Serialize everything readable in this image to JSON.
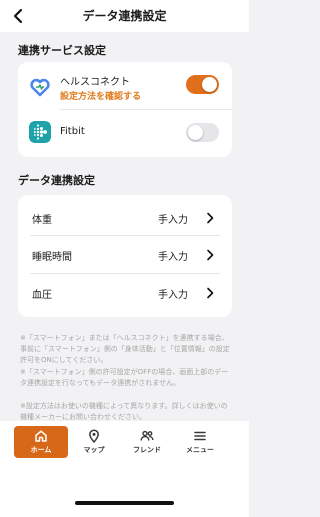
{
  "header": {
    "title": "データ連携設定"
  },
  "services_section": {
    "title": "連携サービス設定",
    "items": [
      {
        "name": "ヘルスコネクト",
        "link": "設定方法を確認する",
        "enabled": true,
        "icon": "health-connect-icon"
      },
      {
        "name": "Fitbit",
        "enabled": false,
        "icon": "fitbit-icon"
      }
    ]
  },
  "data_section": {
    "title": "データ連携設定",
    "items": [
      {
        "label": "体重",
        "value": "手入力"
      },
      {
        "label": "睡眠時間",
        "value": "手入力"
      },
      {
        "label": "血圧",
        "value": "手入力"
      }
    ]
  },
  "notes": {
    "note1": "※「スマートフォン」または「ヘルスコネクト」を連携する場合、事前に「スマートフォン」側の「身体活動」と「位置情報」の設定許可をONにしてください。",
    "note2": "※「スマートフォン」側の許可設定がOFFの場合、画面上部のデータ連携設定を行なってもデータ連携がされません。",
    "note3": "※設定方法はお使いの機種によって異なります。詳しくはお使いの機種メーカーにお問い合わせください。"
  },
  "tabbar": {
    "tabs": [
      {
        "label": "ホーム",
        "icon": "home-icon",
        "active": true
      },
      {
        "label": "マップ",
        "icon": "map-pin-icon",
        "active": false
      },
      {
        "label": "フレンド",
        "icon": "friends-icon",
        "active": false
      },
      {
        "label": "メニュー",
        "icon": "menu-icon",
        "active": false
      }
    ]
  },
  "colors": {
    "accent": "#e06f1b",
    "background": "#f2f2f4",
    "note_text": "#a7a7a7",
    "fitbit_tile": "#1ea3a8"
  }
}
